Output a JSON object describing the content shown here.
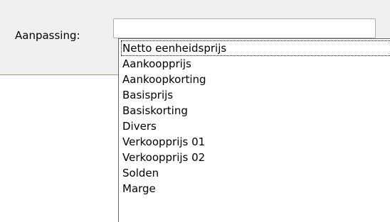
{
  "form": {
    "adjustment_label": "Aanpassing:",
    "adjustment_value": ""
  },
  "dropdown": {
    "focused_index": 0,
    "options": [
      "Netto eenheidsprijs",
      "Aankoopprijs",
      "Aankoopkorting",
      "Basisprijs",
      "Basiskorting",
      "Divers",
      "Verkoopprijs 01",
      "Verkoopprijs 02",
      "Solden",
      "Marge"
    ]
  }
}
